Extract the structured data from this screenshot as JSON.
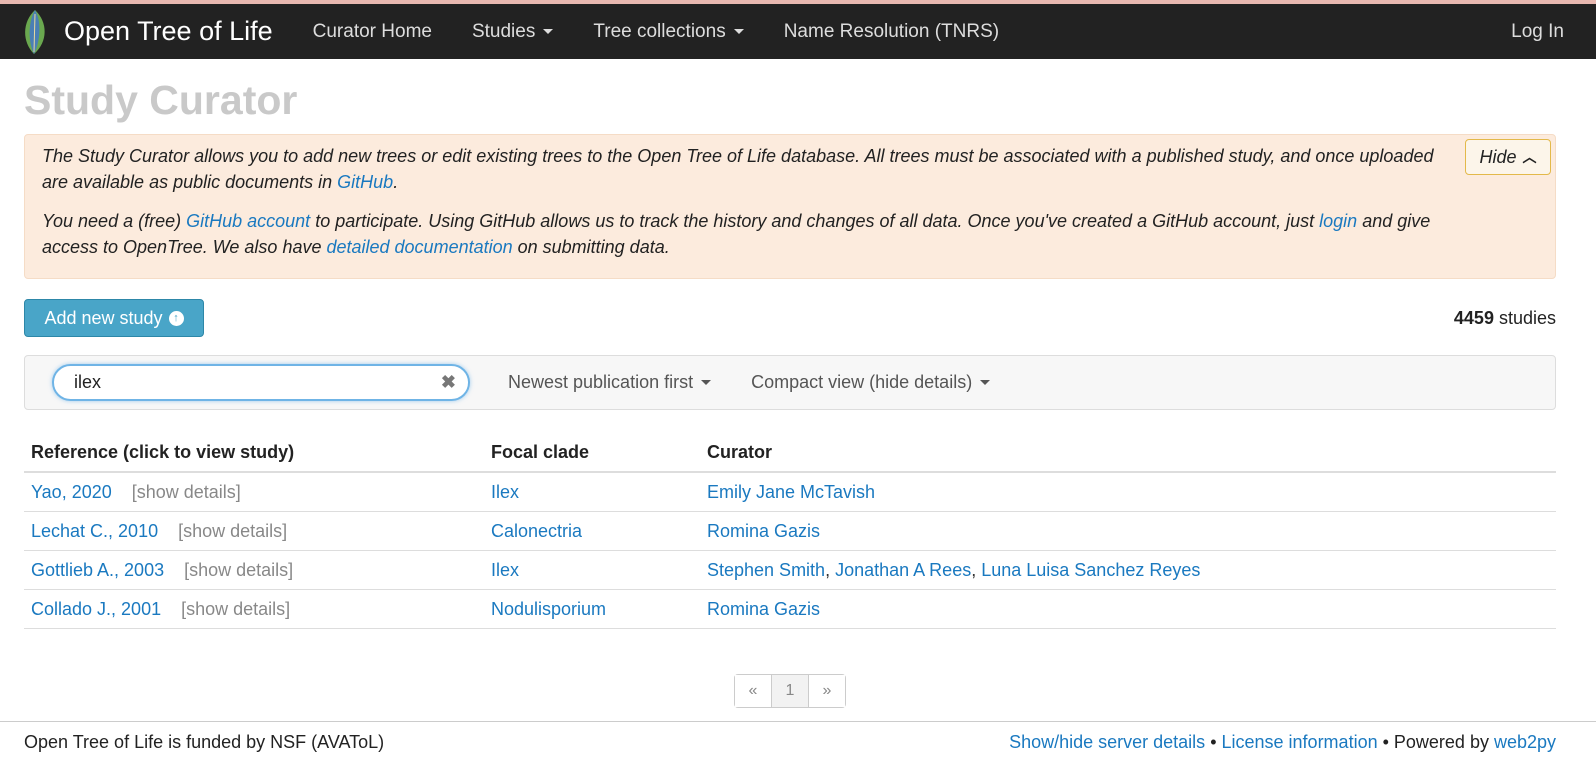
{
  "nav": {
    "brand": "Open Tree of Life",
    "items": [
      {
        "label": "Curator Home",
        "dropdown": false
      },
      {
        "label": "Studies",
        "dropdown": true
      },
      {
        "label": "Tree collections",
        "dropdown": true
      },
      {
        "label": "Name Resolution (TNRS)",
        "dropdown": false
      }
    ],
    "login": "Log In"
  },
  "page_title": "Study Curator",
  "info": {
    "hide_label": "Hide",
    "p1_text": "The Study Curator allows you to add new trees or edit existing trees to the Open Tree of Life database. All trees must be associated with a published study, and once uploaded are available as public documents in ",
    "p1_link": "GitHub",
    "p1_end": ".",
    "p2_a": "You need a (free) ",
    "p2_link1": "GitHub account",
    "p2_b": " to participate. Using GitHub allows us to track the history and changes of all data. Once you've created a GitHub account, just ",
    "p2_link2": "login",
    "p2_c": " and give access to OpenTree. We also have ",
    "p2_link3": "detailed documentation",
    "p2_d": " on submitting data."
  },
  "actions": {
    "add_label": "Add new study",
    "count_number": "4459",
    "count_label": " studies"
  },
  "filters": {
    "search_value": "ilex",
    "sort_label": "Newest publication first",
    "view_label": "Compact view (hide details)"
  },
  "table": {
    "headers": [
      "Reference (click to view study)",
      "Focal clade",
      "Curator"
    ],
    "details_label": "[show details]",
    "rows": [
      {
        "reference": "Yao, 2020",
        "clade": "Ilex",
        "curators": [
          "Emily Jane McTavish"
        ]
      },
      {
        "reference": "Lechat C., 2010",
        "clade": "Calonectria",
        "curators": [
          "Romina Gazis"
        ]
      },
      {
        "reference": "Gottlieb A., 2003",
        "clade": "Ilex",
        "curators": [
          "Stephen Smith",
          "Jonathan A Rees",
          "Luna Luisa Sanchez Reyes"
        ]
      },
      {
        "reference": "Collado J., 2001",
        "clade": "Nodulisporium",
        "curators": [
          "Romina Gazis"
        ]
      }
    ]
  },
  "pagination": {
    "prev": "«",
    "page": "1",
    "next": "»"
  },
  "footer": {
    "left": "Open Tree of Life is funded by NSF (AVAToL)",
    "link1": "Show/hide server details",
    "sep": " • ",
    "link2": "License information",
    "powered": " • Powered by ",
    "link3": "web2py"
  },
  "colors": {
    "navbar": "#222222",
    "link": "#1a79c0",
    "info_bg": "#fcebdd",
    "add_button": "#49a5c8"
  }
}
